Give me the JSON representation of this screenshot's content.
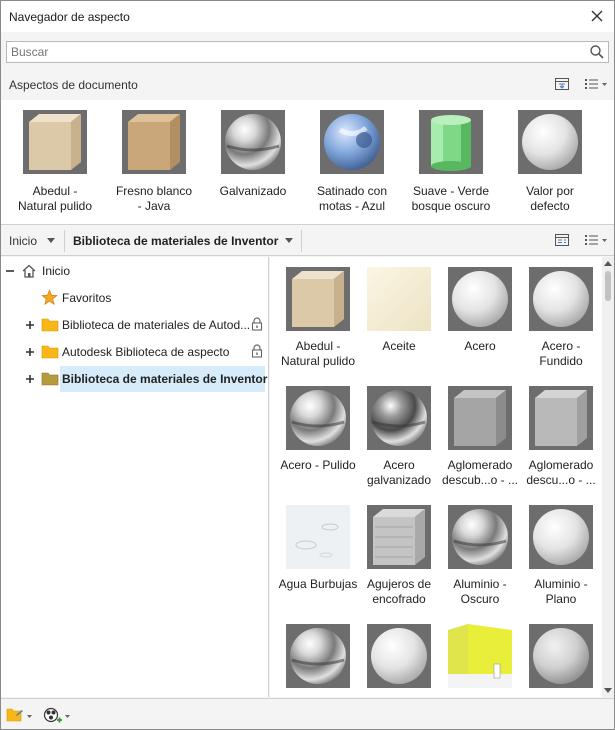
{
  "window": {
    "title": "Navegador de aspecto"
  },
  "search": {
    "placeholder": "Buscar",
    "value": "Buscar"
  },
  "document_section": {
    "label": "Aspectos de documento",
    "items": [
      {
        "label": "Abedul -\nNatural pulido",
        "material": "wood-light"
      },
      {
        "label": "Fresno blanco\n- Java",
        "material": "wood-tan"
      },
      {
        "label": "Galvanizado",
        "material": "chrome-sphere"
      },
      {
        "label": "Satinado con\nmotas - Azul",
        "material": "blue-sphere"
      },
      {
        "label": "Suave - Verde\nbosque oscuro",
        "material": "green-cylinder"
      },
      {
        "label": "Valor por\ndefecto",
        "material": "white-sphere"
      }
    ]
  },
  "library_bar": {
    "home": "Inicio",
    "current_library": "Biblioteca de materiales de Inventor"
  },
  "tree": {
    "items": [
      {
        "label": "Inicio",
        "icon": "home-icon"
      },
      {
        "label": "Favoritos",
        "icon": "star-icon"
      },
      {
        "label": "Biblioteca de materiales de Autod...",
        "icon": "folder-icon",
        "locked": true
      },
      {
        "label": "Autodesk Biblioteca de aspecto",
        "icon": "folder-icon",
        "locked": true
      },
      {
        "label": "Biblioteca de materiales de Inventor",
        "icon": "folder-icon",
        "selected": true
      }
    ]
  },
  "grid": {
    "items": [
      {
        "label": "Abedul -\nNatural pulido",
        "material": "wood-light"
      },
      {
        "label": "Aceite",
        "material": "cream-flat"
      },
      {
        "label": "Acero",
        "material": "white-sphere"
      },
      {
        "label": "Acero -\nFundido",
        "material": "white-sphere"
      },
      {
        "label": "Acero - Pulido",
        "material": "chrome-sphere"
      },
      {
        "label": "Acero\ngalvanizado",
        "material": "chrome-sphere-dark"
      },
      {
        "label": "Aglomerado\ndescub...o - ...",
        "material": "grey-cube"
      },
      {
        "label": "Aglomerado\ndescu...o - ...",
        "material": "grey-cube-smooth"
      },
      {
        "label": "Agua Burbujas",
        "material": "water-flat"
      },
      {
        "label": "Agujeros de\nencofrado",
        "material": "concrete-cube"
      },
      {
        "label": "Aluminio -\nOscuro",
        "material": "chrome-sphere"
      },
      {
        "label": "Aluminio -\nPlano",
        "material": "white-sphere"
      },
      {
        "label": "",
        "material": "chrome-sphere"
      },
      {
        "label": "",
        "material": "white-sphere"
      },
      {
        "label": "",
        "material": "yellow-scene"
      },
      {
        "label": "",
        "material": "white-sphere-dim"
      }
    ]
  },
  "colors": {
    "selection": "#d7ecfa",
    "folder": "#f7b718",
    "star": "#f5a623",
    "thumb_bg": "#6d6d6d"
  }
}
